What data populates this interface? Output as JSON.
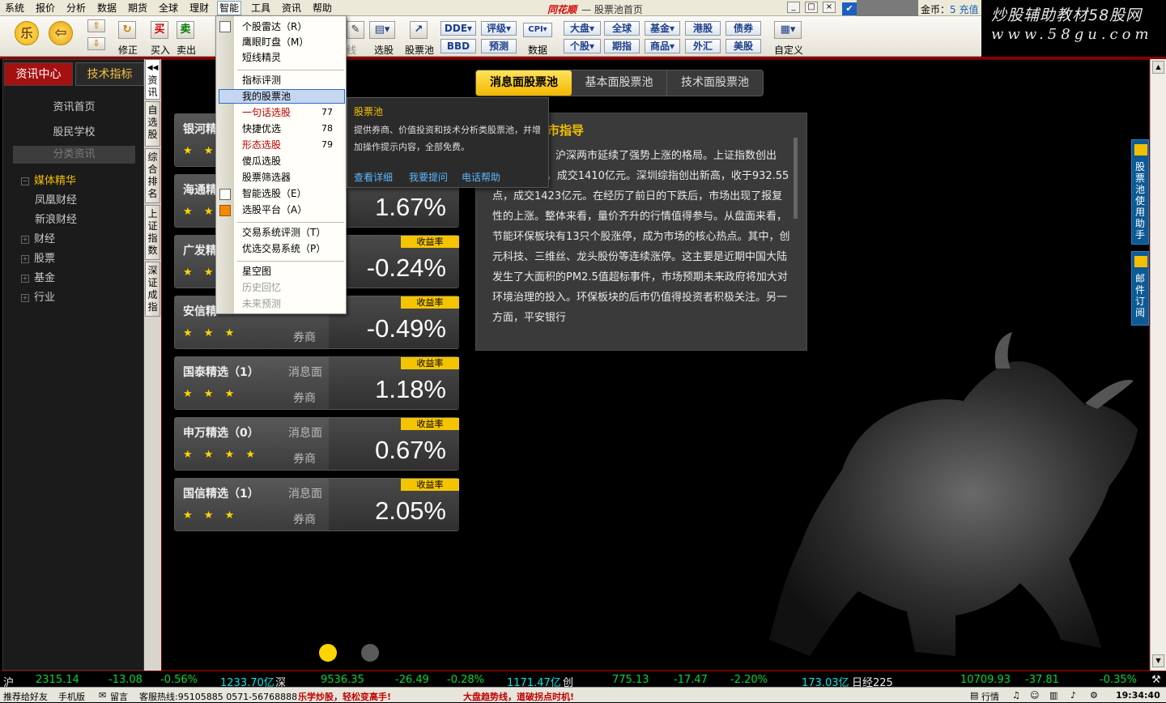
{
  "menu": [
    "系统",
    "报价",
    "分析",
    "数据",
    "期货",
    "全球",
    "理财",
    "智能",
    "工具",
    "资讯",
    "帮助"
  ],
  "app_title": {
    "logo": "同花顺",
    "page": "股票池首页"
  },
  "coins": {
    "label": "金币：",
    "value": "5",
    "action": "充值"
  },
  "brand": {
    "line1": "炒股辅助教材58股网",
    "line2": "www.58gu.com"
  },
  "toolbar": {
    "buttons": [
      "买入",
      "卖出",
      "修正",
      "选股",
      "股票池",
      "数据",
      "自定义"
    ],
    "small": [
      "DDE",
      "评级",
      "CPI",
      "大盘",
      "全球",
      "基金",
      "港股",
      "债券",
      "BBD",
      "预测",
      "个股",
      "期指",
      "商品",
      "外汇",
      "美股"
    ],
    "partial_label": "线"
  },
  "leftnav": {
    "tab_active": "资讯中心",
    "tab_inactive": "技术指标",
    "items": [
      "资讯首页",
      "股民学校"
    ],
    "section": "分类资讯",
    "tree": [
      {
        "label": "媒体精华",
        "expanded": true,
        "active": true
      },
      {
        "label": "凤凰财经",
        "child": true
      },
      {
        "label": "新浪财经",
        "child": true
      },
      {
        "label": "财经"
      },
      {
        "label": "股票"
      },
      {
        "label": "基金"
      },
      {
        "label": "行业"
      }
    ]
  },
  "vtabs": [
    "资讯",
    "自选股",
    "综合排名",
    "上证指数",
    "深证成指"
  ],
  "segments": [
    "消息面股票池",
    "基本面股票池",
    "技术面股票池"
  ],
  "cards": [
    {
      "name": "银河精",
      "kind": "",
      "broker": "",
      "stars": "★ ★",
      "return": "",
      "tag": ""
    },
    {
      "name": "海通精",
      "kind": "",
      "broker": "",
      "stars": "★ ★",
      "return": "1.67%",
      "tag": ""
    },
    {
      "name": "广发精",
      "kind": "",
      "broker": "",
      "stars": "★ ★",
      "return": "-0.24%",
      "tag": "收益率"
    },
    {
      "name": "安信精",
      "kind": "",
      "broker": "券商",
      "stars": "★ ★ ★",
      "return": "-0.49%",
      "tag": "收益率"
    },
    {
      "name": "国泰精选（1）",
      "kind": "消息面",
      "broker": "券商",
      "stars": "★ ★ ★",
      "return": "1.18%",
      "tag": "收益率"
    },
    {
      "name": "申万精选（0）",
      "kind": "消息面",
      "broker": "券商",
      "stars": "★ ★ ★ ★",
      "return": "0.67%",
      "tag": "收益率"
    },
    {
      "name": "国信精选（1）",
      "kind": "消息面",
      "broker": "券商",
      "stars": "★ ★ ★",
      "return": "2.05%",
      "tag": "收益率"
    }
  ],
  "news": {
    "title": "市指导",
    "body": "　　　　　　沪深两市延续了强势上涨的格局。上证指数创出　　　　　　2325.68点，成交1410亿元。深圳综指创出新高，收于932.55点，成交1423亿元。在经历了前日的下跌后，市场出现了报复性的上涨。整体来看，量价齐升的行情值得参与。从盘面来看，节能环保板块有13只个股涨停，成为市场的核心热点。其中，创元科技、三维丝、龙头股份等连续涨停。这主要是近期中国大陆发生了大面积的PM2.5值超标事件，市场预期未来政府将加大对环境治理的投入。环保板块的后市仍值得投资者积极关注。另一方面，平安银行"
  },
  "dropdown": {
    "items": [
      {
        "label": "个股雷达（R）"
      },
      {
        "label": "鹰眼盯盘（M）"
      },
      {
        "label": "短线精灵"
      },
      {
        "label": "指标评测"
      },
      {
        "label": "我的股票池",
        "selected": true
      },
      {
        "label": "一句话选股",
        "num": "77",
        "red": true
      },
      {
        "label": "快捷优选",
        "num": "78"
      },
      {
        "label": "形态选股",
        "num": "79",
        "red": true
      },
      {
        "label": "傻瓜选股"
      },
      {
        "label": "股票筛选器"
      },
      {
        "label": "智能选股（E）"
      },
      {
        "label": "选股平台（A）"
      },
      {
        "label": "交易系统评测（T）"
      },
      {
        "label": "优选交易系统（P）"
      },
      {
        "label": "星空图"
      },
      {
        "label": "历史回忆",
        "disabled": true
      },
      {
        "label": "未来预测",
        "disabled": true
      }
    ]
  },
  "tooltip": {
    "title": "股票池",
    "text": "提供券商、价值投资和技术分析类股票池，并增加操作提示内容，全部免费。",
    "links": [
      "查看详细",
      "我要提问",
      "电话帮助"
    ]
  },
  "side_buttons": [
    "股票池使用助手",
    "邮件订阅"
  ],
  "ticker": {
    "sh_label": "沪",
    "sh": "2315.14",
    "sh_chg": "-13.08",
    "sh_pct": "-0.56%",
    "sh_amt": "1233.70亿",
    "sz_label": "深",
    "sz": "9536.35",
    "sz_chg": "-26.49",
    "sz_pct": "-0.28%",
    "sz_amt": "1171.47亿",
    "cy_label": "创",
    "cy": "775.13",
    "cy_chg": "-17.47",
    "cy_pct": "-2.20%",
    "cy_amt": "173.03亿",
    "nk_label": "日经225",
    "nk": "10709.93",
    "nk_chg": "-37.81",
    "nk_pct": "-0.35%"
  },
  "status": {
    "items": [
      "推荐给好友",
      "手机版",
      "留言",
      "客服热线:95105885 0571-56768888"
    ],
    "promo1": "乐学炒股，轻松变高手!",
    "promo2": "大盘趋势线，道破拐点时机!",
    "right": "行情",
    "time": "19:34:40"
  }
}
